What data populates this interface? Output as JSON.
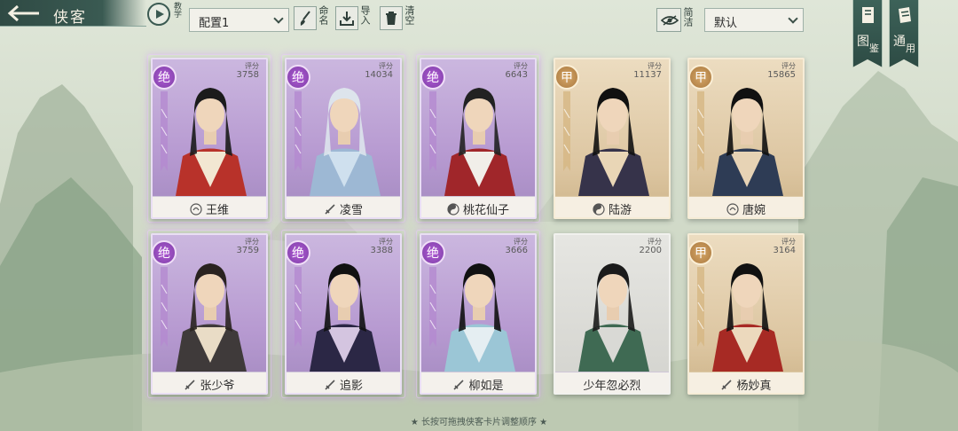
{
  "header": {
    "title": "侠客",
    "teach_label": "教学",
    "config_value": "配置1",
    "rename_label": "命名",
    "import_label": "导入",
    "clear_label": "清空",
    "simple_label": "简洁",
    "sort_value": "默认",
    "atlas_label_1": "图",
    "atlas_label_2": "鉴",
    "general_label_1": "通",
    "general_label_2": "用"
  },
  "cards": [
    {
      "name": "王维",
      "rank": "绝",
      "score_label": "评分",
      "score": "3758",
      "name_icon": "spiral-icon"
    },
    {
      "name": "凌雪",
      "rank": "绝",
      "score_label": "评分",
      "score": "14034",
      "name_icon": "sword-icon"
    },
    {
      "name": "桃花仙子",
      "rank": "绝",
      "score_label": "评分",
      "score": "6643",
      "name_icon": "yinyang-icon"
    },
    {
      "name": "陆游",
      "rank": "甲",
      "score_label": "评分",
      "score": "11137",
      "name_icon": "yinyang-icon"
    },
    {
      "name": "唐婉",
      "rank": "甲",
      "score_label": "评分",
      "score": "15865",
      "name_icon": "spiral-icon"
    },
    {
      "name": "张少爷",
      "rank": "绝",
      "score_label": "评分",
      "score": "3759",
      "name_icon": "sword-icon"
    },
    {
      "name": "追影",
      "rank": "绝",
      "score_label": "评分",
      "score": "3388",
      "name_icon": "sword-icon"
    },
    {
      "name": "柳如是",
      "rank": "绝",
      "score_label": "评分",
      "score": "3666",
      "name_icon": "sword-icon"
    },
    {
      "name": "少年忽必烈",
      "rank": "",
      "score_label": "评分",
      "score": "2200",
      "name_icon": ""
    },
    {
      "name": "杨妙真",
      "rank": "甲",
      "score_label": "评分",
      "score": "3164",
      "name_icon": "sword-icon"
    }
  ],
  "footer": {
    "hint": "★ 长按可拖拽侠客卡片调整顺序 ★"
  },
  "colors": {
    "jue_accent": "#9b59c9",
    "jia_accent": "#c49254",
    "banner_green": "#2d4b44"
  }
}
